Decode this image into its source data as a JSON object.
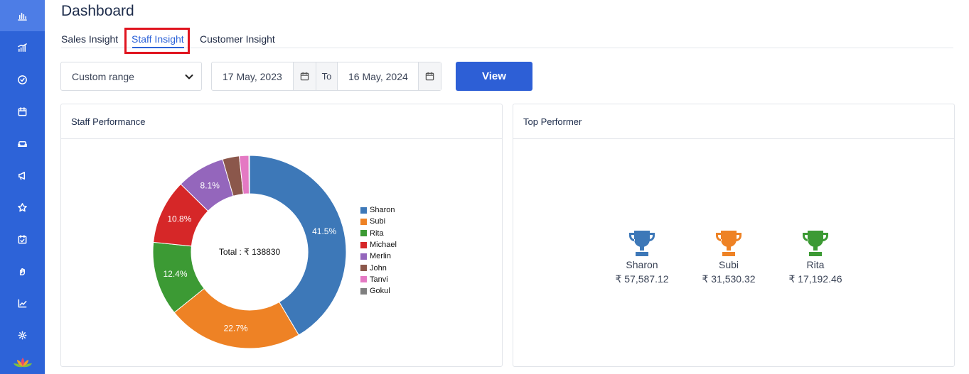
{
  "sidebar": {
    "items": [
      {
        "icon": "bar-chart-icon"
      },
      {
        "icon": "signal-bars-icon"
      },
      {
        "icon": "check-circle-icon"
      },
      {
        "icon": "calendar-icon"
      },
      {
        "icon": "sofa-icon"
      },
      {
        "icon": "megaphone-icon"
      },
      {
        "icon": "star-icon"
      },
      {
        "icon": "calendar-check-icon"
      },
      {
        "icon": "hand-icon"
      },
      {
        "icon": "trend-chart-icon"
      },
      {
        "icon": "settings-icon"
      }
    ],
    "logo": "lotus-logo"
  },
  "page": {
    "title": "Dashboard"
  },
  "tabs": [
    {
      "label": "Sales Insight",
      "active": false
    },
    {
      "label": "Staff Insight",
      "active": true
    },
    {
      "label": "Customer Insight",
      "active": false
    }
  ],
  "filters": {
    "range_selected": "Custom range",
    "from_date": "17 May, 2023",
    "to_label": "To",
    "to_date": "16 May, 2024",
    "view_label": "View"
  },
  "staff_performance": {
    "title": "Staff Performance",
    "center_label": "Total : ₹ 138830"
  },
  "chart_data": {
    "type": "pie",
    "variant": "donut",
    "categories": [
      "Sharon",
      "Subi",
      "Rita",
      "Michael",
      "Merlin",
      "John",
      "Tanvi",
      "Gokul"
    ],
    "values": [
      41.5,
      22.7,
      12.4,
      10.8,
      8.1,
      2.8,
      1.6,
      0.1
    ],
    "value_labels": [
      "41.5%",
      "22.7%",
      "12.4%",
      "10.8%",
      "8.1%",
      "",
      "",
      ""
    ],
    "colors": [
      "#3d78b8",
      "#ee8225",
      "#3c9a34",
      "#d62728",
      "#9466bc",
      "#8b574b",
      "#e479c3",
      "#7f7f7f"
    ],
    "legend_position": "right"
  },
  "top_performer": {
    "title": "Top Performer",
    "items": [
      {
        "name": "Sharon",
        "amount": "₹ 57,587.12",
        "color": "#3d78b8"
      },
      {
        "name": "Subi",
        "amount": "₹ 31,530.32",
        "color": "#ee8225"
      },
      {
        "name": "Rita",
        "amount": "₹ 17,192.46",
        "color": "#3c9a34"
      }
    ]
  }
}
